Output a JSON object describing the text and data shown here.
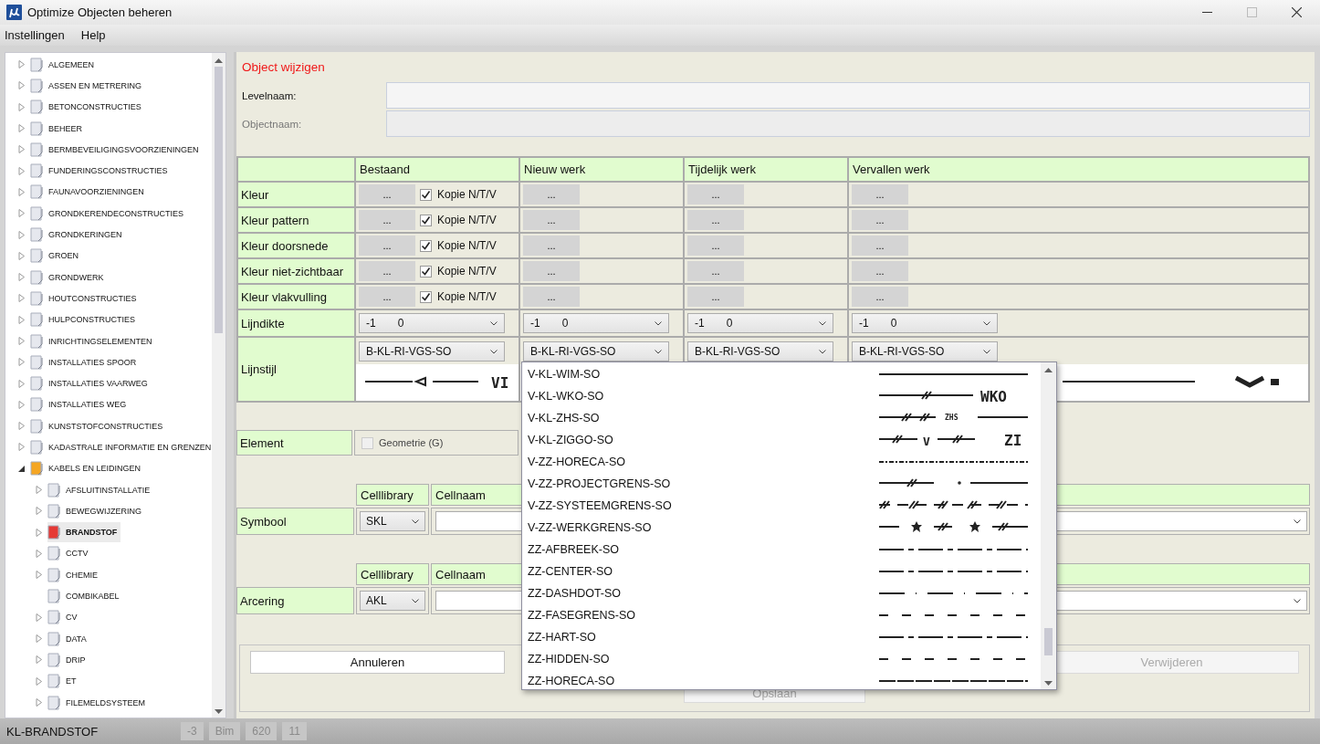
{
  "window": {
    "title": "Optimize Objecten beheren"
  },
  "menu": [
    "Instellingen",
    "Help"
  ],
  "tree": [
    {
      "label": "ALGEMEEN",
      "kind": "branch",
      "expanded": false,
      "selected": false
    },
    {
      "label": "ASSEN EN METRERING",
      "kind": "branch",
      "expanded": false,
      "selected": false
    },
    {
      "label": "BETONCONSTRUCTIES",
      "kind": "branch",
      "expanded": false,
      "selected": false
    },
    {
      "label": "BEHEER",
      "kind": "branch",
      "expanded": false,
      "selected": false
    },
    {
      "label": "BERMBEVEILIGINGSVOORZIENINGEN",
      "kind": "branch",
      "expanded": false,
      "selected": false
    },
    {
      "label": "FUNDERINGSCONSTRUCTIES",
      "kind": "branch",
      "expanded": false,
      "selected": false
    },
    {
      "label": "FAUNAVOORZIENINGEN",
      "kind": "branch",
      "expanded": false,
      "selected": false
    },
    {
      "label": "GRONDKERENDECONSTRUCTIES",
      "kind": "branch",
      "expanded": false,
      "selected": false
    },
    {
      "label": "GRONDKERINGEN",
      "kind": "branch",
      "expanded": false,
      "selected": false
    },
    {
      "label": "GROEN",
      "kind": "branch",
      "expanded": false,
      "selected": false
    },
    {
      "label": "GRONDWERK",
      "kind": "branch",
      "expanded": false,
      "selected": false
    },
    {
      "label": "HOUTCONSTRUCTIES",
      "kind": "branch",
      "expanded": false,
      "selected": false
    },
    {
      "label": "HULPCONSTRUCTIES",
      "kind": "branch",
      "expanded": false,
      "selected": false
    },
    {
      "label": "INRICHTINGSELEMENTEN",
      "kind": "branch",
      "expanded": false,
      "selected": false
    },
    {
      "label": "INSTALLATIES SPOOR",
      "kind": "branch",
      "expanded": false,
      "selected": false
    },
    {
      "label": "INSTALLATIES VAARWEG",
      "kind": "branch",
      "expanded": false,
      "selected": false
    },
    {
      "label": "INSTALLATIES WEG",
      "kind": "branch",
      "expanded": false,
      "selected": false
    },
    {
      "label": "KUNSTSTOFCONSTRUCTIES",
      "kind": "branch",
      "expanded": false,
      "selected": false
    },
    {
      "label": "KADASTRALE INFORMATIE EN GRENZEN",
      "kind": "branch",
      "expanded": false,
      "selected": false
    },
    {
      "label": "KABELS EN LEIDINGEN",
      "kind": "branch",
      "expanded": true,
      "selected": false,
      "children": [
        {
          "label": "AFSLUITINSTALLATIE",
          "kind": "branch",
          "expanded": false,
          "selected": false
        },
        {
          "label": "BEWEGWIJZERING",
          "kind": "branch",
          "expanded": false,
          "selected": false
        },
        {
          "label": "BRANDSTOF",
          "kind": "branch",
          "expanded": false,
          "selected": true
        },
        {
          "label": "CCTV",
          "kind": "branch",
          "expanded": false,
          "selected": false
        },
        {
          "label": "CHEMIE",
          "kind": "branch",
          "expanded": false,
          "selected": false
        },
        {
          "label": "COMBIKABEL",
          "kind": "leaf",
          "selected": false
        },
        {
          "label": "CV",
          "kind": "branch",
          "expanded": false,
          "selected": false
        },
        {
          "label": "DATA",
          "kind": "branch",
          "expanded": false,
          "selected": false
        },
        {
          "label": "DRIP",
          "kind": "branch",
          "expanded": false,
          "selected": false
        },
        {
          "label": "ET",
          "kind": "branch",
          "expanded": false,
          "selected": false
        },
        {
          "label": "FILEMELDSYSTEEM",
          "kind": "branch",
          "expanded": false,
          "selected": false
        }
      ]
    }
  ],
  "form": {
    "title": "Object wijzigen",
    "fields": [
      {
        "label": "Levelnaam:",
        "disabled": false
      },
      {
        "label": "Objectnaam:",
        "disabled": true
      }
    ]
  },
  "table": {
    "columns": [
      "Bestaand",
      "Nieuw werk",
      "Tijdelijk werk",
      "Vervallen werk"
    ],
    "color_rows": [
      {
        "label": "Kleur",
        "buttons": [
          "...",
          "...",
          "...",
          "..."
        ],
        "copy": {
          "label": "Kopie N/T/V",
          "checked": true
        }
      },
      {
        "label": "Kleur pattern",
        "buttons": [
          "...",
          "...",
          "...",
          "..."
        ],
        "copy": {
          "label": "Kopie N/T/V",
          "checked": true
        }
      },
      {
        "label": "Kleur doorsnede",
        "buttons": [
          "...",
          "...",
          "...",
          "..."
        ],
        "copy": {
          "label": "Kopie N/T/V",
          "checked": true
        }
      },
      {
        "label": "Kleur niet-zichtbaar",
        "buttons": [
          "...",
          "...",
          "...",
          "..."
        ],
        "copy": {
          "label": "Kopie N/T/V",
          "checked": true
        }
      },
      {
        "label": "Kleur vlakvulling",
        "buttons": [
          "...",
          "...",
          "...",
          "..."
        ],
        "copy": {
          "label": "Kopie N/T/V",
          "checked": true
        }
      }
    ],
    "thickness_row": {
      "label": "Lijndikte",
      "selects": [
        [
          "-1",
          "0"
        ],
        [
          "-1",
          "0"
        ],
        [
          "-1",
          "0"
        ],
        [
          "-1",
          "0"
        ]
      ]
    },
    "style_row": {
      "label": "Lijnstijl",
      "cells": [
        {
          "select": "B-KL-RI-VGS-SO",
          "preview": {
            "kind": "arrow",
            "symbols": [
              "VI"
            ]
          }
        },
        {
          "select": "B-KL-RI-VGS-SO"
        },
        {
          "select": "B-KL-RI-VGS-SO"
        },
        {
          "select": "B-KL-RI-VGS-SO",
          "preview": {
            "kind": "chevron"
          }
        }
      ]
    }
  },
  "element": {
    "label": "Element",
    "option": {
      "label": "Geometrie (G)",
      "checked": false,
      "disabled": true
    }
  },
  "symbol": {
    "label": "Symbool",
    "headers": [
      "Celllibrary",
      "Cellnaam"
    ],
    "library": "SKL"
  },
  "hatching": {
    "label": "Arcering",
    "headers": [
      "Celllibrary",
      "Cellnaam"
    ],
    "library": "AKL"
  },
  "actions": [
    {
      "label": "Annuleren",
      "disabled": false
    },
    {
      "label": "Opslaan",
      "disabled": true
    },
    {
      "label": "Verwijderen",
      "disabled": true
    }
  ],
  "dropdown": {
    "items": [
      {
        "name": "V-KL-WIM-SO",
        "kind": "solid"
      },
      {
        "name": "V-KL-WKO-SO",
        "kind": "hatch-end",
        "symbols": [
          "WKO"
        ]
      },
      {
        "name": "V-KL-ZHS-SO",
        "kind": "hatch-inline",
        "symbols": [
          "ZHS"
        ]
      },
      {
        "name": "V-KL-ZIGGO-SO",
        "kind": "hatch-double",
        "symbols": [
          "V",
          "ZI"
        ]
      },
      {
        "name": "V-ZZ-HORECA-SO",
        "kind": "dense"
      },
      {
        "name": "V-ZZ-PROJECTGRENS-SO",
        "kind": "hatch-gap"
      },
      {
        "name": "V-ZZ-SYSTEEMGRENS-SO",
        "kind": "hatch-repeat"
      },
      {
        "name": "V-ZZ-WERKGRENS-SO",
        "kind": "star"
      },
      {
        "name": "ZZ-AFBREEK-SO",
        "kind": "dash-dot"
      },
      {
        "name": "ZZ-CENTER-SO",
        "kind": "dash-dot"
      },
      {
        "name": "ZZ-DASHDOT-SO",
        "kind": "dash-point"
      },
      {
        "name": "ZZ-FASEGRENS-SO",
        "kind": "dash"
      },
      {
        "name": "ZZ-HART-SO",
        "kind": "dash-dot"
      },
      {
        "name": "ZZ-HIDDEN-SO",
        "kind": "dash"
      },
      {
        "name": "ZZ-HORECA-SO",
        "kind": "long-dash"
      }
    ]
  },
  "status_bar": {
    "text": "KL-BRANDSTOF",
    "fields": [
      "-3",
      "Bim",
      "620",
      "11"
    ]
  }
}
